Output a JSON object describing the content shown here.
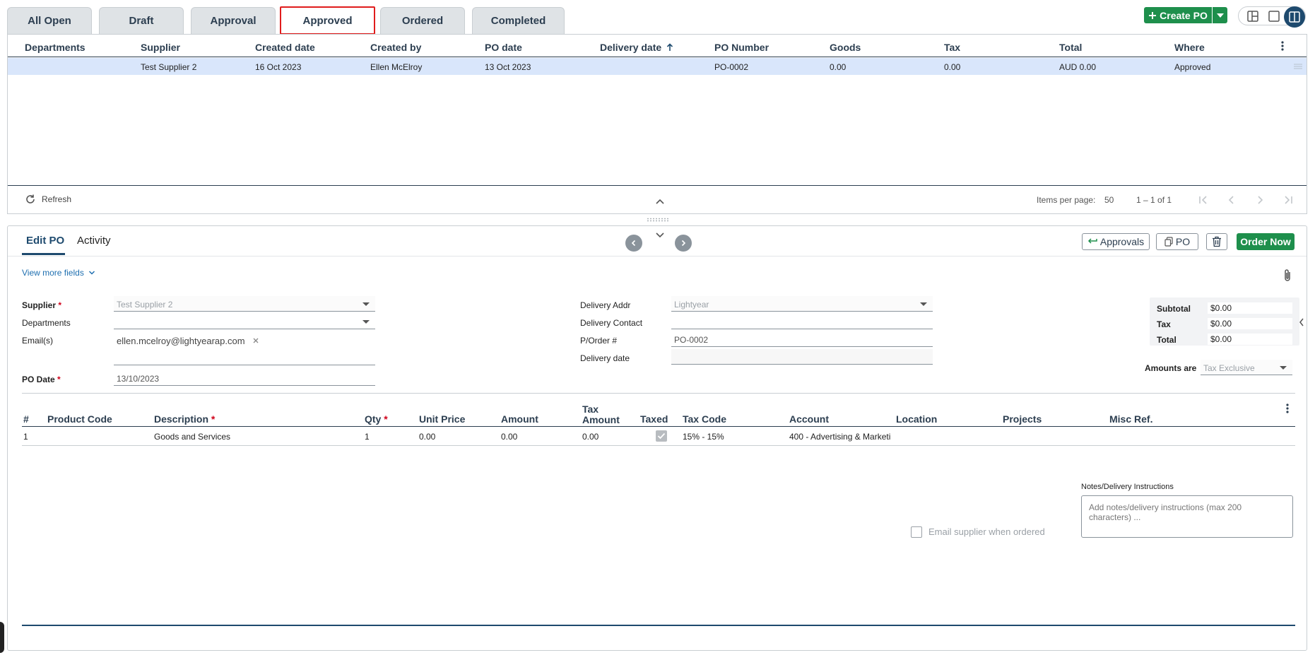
{
  "tabs": [
    {
      "label": "All Open"
    },
    {
      "label": "Draft"
    },
    {
      "label": "Approval"
    },
    {
      "label": "Approved",
      "active": true
    },
    {
      "label": "Ordered"
    },
    {
      "label": "Completed"
    }
  ],
  "toolbar": {
    "create_label": "Create PO"
  },
  "grid": {
    "headers": [
      "Departments",
      "Supplier",
      "Created date",
      "Created by",
      "PO date",
      "Delivery date",
      "PO Number",
      "Goods",
      "Tax",
      "Total",
      "Where"
    ],
    "sort_column": "Delivery date",
    "rows": [
      {
        "departments": "",
        "supplier": "Test Supplier 2",
        "created_date": "16 Oct 2023",
        "created_by": "Ellen McElroy",
        "po_date": "13 Oct 2023",
        "delivery_date": "",
        "po_number": "PO-0002",
        "goods": "0.00",
        "tax": "0.00",
        "total": "AUD 0.00",
        "where": "Approved"
      }
    ],
    "footer": {
      "refresh_label": "Refresh",
      "items_per_page_label": "Items per page:",
      "items_per_page_value": "50",
      "range_text": "1 – 1 of 1"
    }
  },
  "panel": {
    "tabs": [
      {
        "label": "Edit PO",
        "active": true
      },
      {
        "label": "Activity"
      }
    ],
    "buttons": {
      "approvals": "Approvals",
      "po": "PO",
      "order_now": "Order Now"
    },
    "view_more": "View more fields",
    "form": {
      "supplier_label": "Supplier",
      "supplier_value": "Test Supplier 2",
      "departments_label": "Departments",
      "departments_value": "",
      "emails_label": "Email(s)",
      "email_chip": "ellen.mcelroy@lightyearap.com",
      "po_date_label": "PO Date",
      "po_date_value": "13/10/2023",
      "delivery_addr_label": "Delivery Addr",
      "delivery_addr_value": "Lightyear",
      "delivery_contact_label": "Delivery Contact",
      "delivery_contact_value": "",
      "porder_label": "P/Order #",
      "porder_value": "PO-0002",
      "delivery_date_label": "Delivery date",
      "delivery_date_value": ""
    },
    "totals": {
      "subtotal_label": "Subtotal",
      "subtotal": "$0.00",
      "tax_label": "Tax",
      "tax": "$0.00",
      "total_label": "Total",
      "total": "$0.00",
      "amounts_are_label": "Amounts are",
      "amounts_are_value": "Tax Exclusive"
    },
    "lines": {
      "headers": {
        "num": "#",
        "product_code": "Product Code",
        "description": "Description",
        "qty": "Qty",
        "unit_price": "Unit Price",
        "amount": "Amount",
        "tax_amount_1": "Tax",
        "tax_amount_2": "Amount",
        "taxed": "Taxed",
        "tax_code": "Tax Code",
        "account": "Account",
        "location": "Location",
        "projects": "Projects",
        "misc_ref": "Misc Ref."
      },
      "rows": [
        {
          "num": "1",
          "product_code": "",
          "description": "Goods and Services",
          "qty": "1",
          "unit_price": "0.00",
          "amount": "0.00",
          "tax_amount": "0.00",
          "taxed": true,
          "tax_code": "15% - 15%",
          "account": "400 - Advertising & Marketi",
          "location": "",
          "projects": "",
          "misc_ref": ""
        }
      ]
    },
    "notes_label": "Notes/Delivery Instructions",
    "notes_placeholder": "Add notes/delivery instructions (max 200 characters) ...",
    "email_supplier_label": "Email supplier when ordered"
  },
  "colors": {
    "accent": "#1e4a6e",
    "success": "#1e8f4c",
    "active_tab_border": "#e01c1c",
    "selected_row": "#d9e6fb"
  }
}
